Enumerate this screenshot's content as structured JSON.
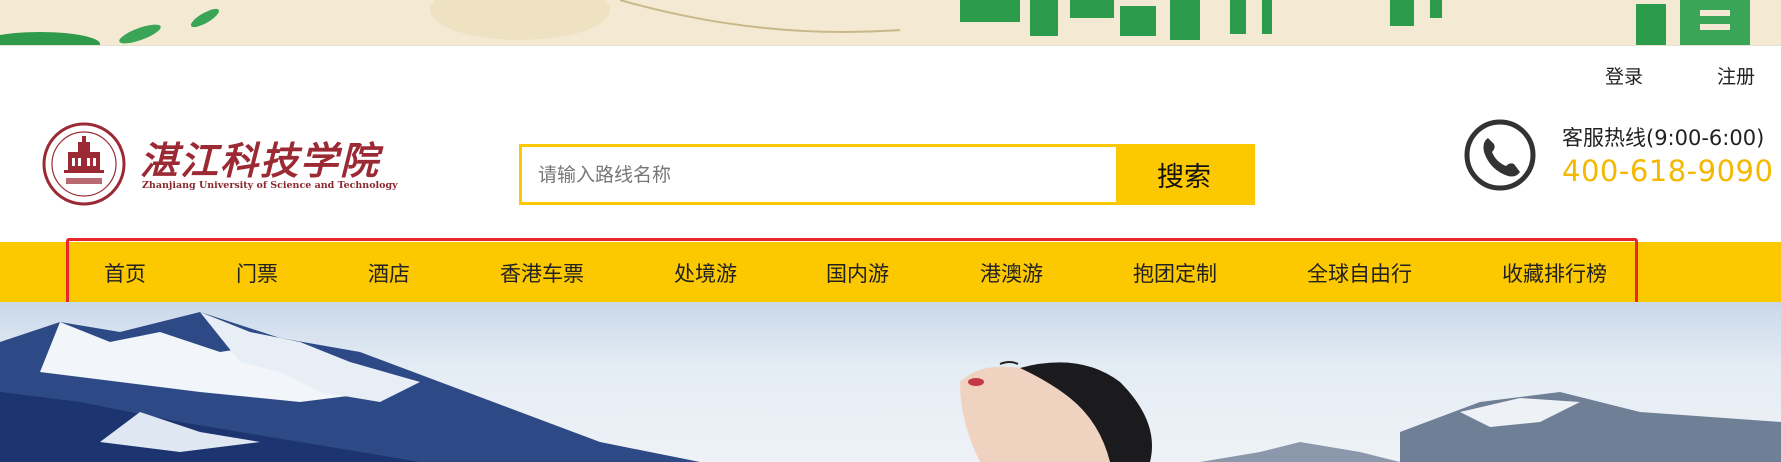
{
  "header": {
    "auth": {
      "login": "登录",
      "register": "注册"
    },
    "logo": {
      "name": "湛江科技学院",
      "subtitle": "Zhanjiang University of Science and Technology"
    },
    "search": {
      "placeholder": "请输入路线名称",
      "value": "",
      "button_label": "搜索"
    },
    "hotline": {
      "label": "客服热线(9:00-6:00)",
      "number": "400-618-9090",
      "icon": "phone-icon"
    }
  },
  "nav": {
    "items": [
      {
        "label": "首页"
      },
      {
        "label": "门票"
      },
      {
        "label": "酒店"
      },
      {
        "label": "香港车票"
      },
      {
        "label": "处境游"
      },
      {
        "label": "国内游"
      },
      {
        "label": "港澳游"
      },
      {
        "label": "抱团定制"
      },
      {
        "label": "全球自由行"
      },
      {
        "label": "收藏排行榜"
      }
    ]
  },
  "colors": {
    "accent": "#fcc800",
    "hotline_number": "#f5b800",
    "highlight_border": "#e8262c",
    "logo": "#9b2a34"
  }
}
